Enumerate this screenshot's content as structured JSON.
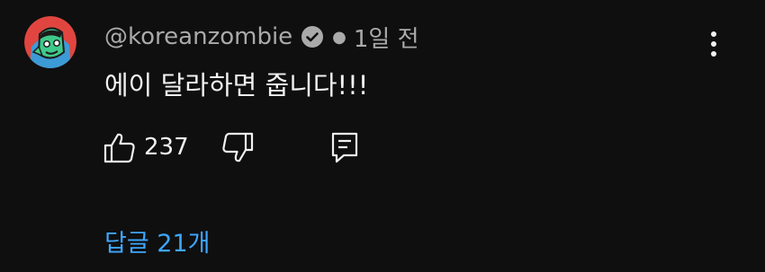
{
  "comment": {
    "author": "@koreanzombie",
    "time": "1일 전",
    "text": "에이 달라하면 줍니다!!!",
    "likes": "237",
    "replies_label": "답글 21개",
    "colors": {
      "background": "#0f0f0f",
      "meta_text": "#aaaaaa",
      "body_text": "#f1f1f1",
      "link": "#3ea6ff"
    }
  }
}
